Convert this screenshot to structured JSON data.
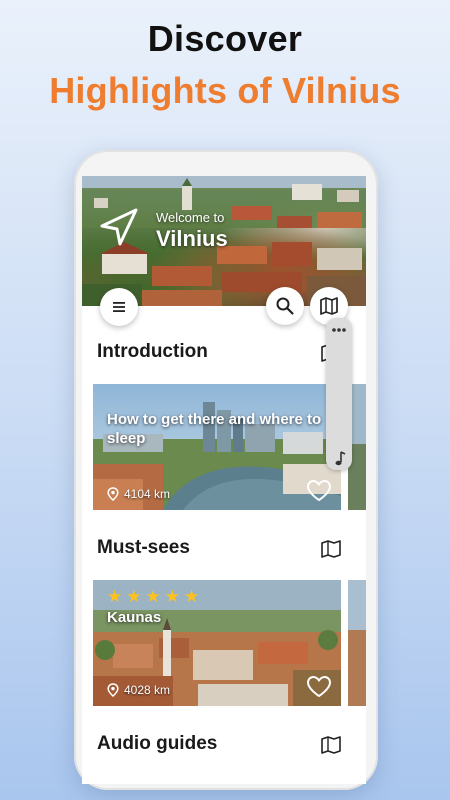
{
  "promo": {
    "title": "Discover",
    "subtitle": "Highlights of Vilnius"
  },
  "hero": {
    "welcome": "Welcome to",
    "city": "Vilnius"
  },
  "sections": {
    "introduction": "Introduction",
    "must_sees": "Must-sees",
    "audio_guides": "Audio guides"
  },
  "cards": {
    "intro_card": {
      "title": "How to get there and where to sleep",
      "distance": "4104 km"
    },
    "must_card": {
      "title": "Kaunas",
      "distance": "4028 km",
      "rating": 5
    }
  },
  "colors": {
    "accent": "#ee7d2f",
    "star": "#ffc21c"
  },
  "icons": {
    "menu": "menu-icon",
    "search": "search-icon",
    "map": "map-icon",
    "navigate": "navigation-arrow-icon",
    "heart": "heart-icon",
    "location": "location-pin-icon",
    "more": "more-dots-icon",
    "music": "music-note-icon"
  }
}
